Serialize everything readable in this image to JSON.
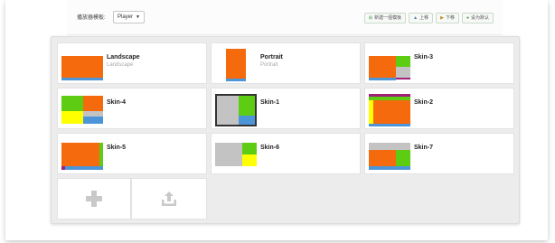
{
  "toolbar": {
    "label": "播放器模板:",
    "player_select": "Player",
    "actions": [
      {
        "label": "新建一個模板",
        "icon": "plus-square-icon",
        "color": "#4a9a4a"
      },
      {
        "label": "上移",
        "icon": "up-arrow-icon",
        "color": "#4a7ab0"
      },
      {
        "label": "下移",
        "icon": "down-arrow-icon",
        "color": "#c08a20"
      },
      {
        "label": "设为默认",
        "icon": "check-icon",
        "color": "#4a9a4a"
      }
    ]
  },
  "colors": {
    "orange": "#f56a0c",
    "green": "#5fcc14",
    "yellow": "#ffff00",
    "gray": "#c3c3c3",
    "blue": "#4d95d9",
    "magenta": "#a0207a"
  },
  "skins": [
    {
      "title": "Landscape",
      "subtitle": "Landscape"
    },
    {
      "title": "Portrait",
      "subtitle": "Portrait"
    },
    {
      "title": "Skin-3",
      "subtitle": ""
    },
    {
      "title": "Skin-4",
      "subtitle": ""
    },
    {
      "title": "Skin-1",
      "subtitle": ""
    },
    {
      "title": "Skin-2",
      "subtitle": ""
    },
    {
      "title": "Skin-5",
      "subtitle": ""
    },
    {
      "title": "Skin-6",
      "subtitle": ""
    },
    {
      "title": "Skin-7",
      "subtitle": ""
    }
  ],
  "add_cell": {
    "add_icon": "plus-icon",
    "upload_icon": "upload-icon"
  }
}
